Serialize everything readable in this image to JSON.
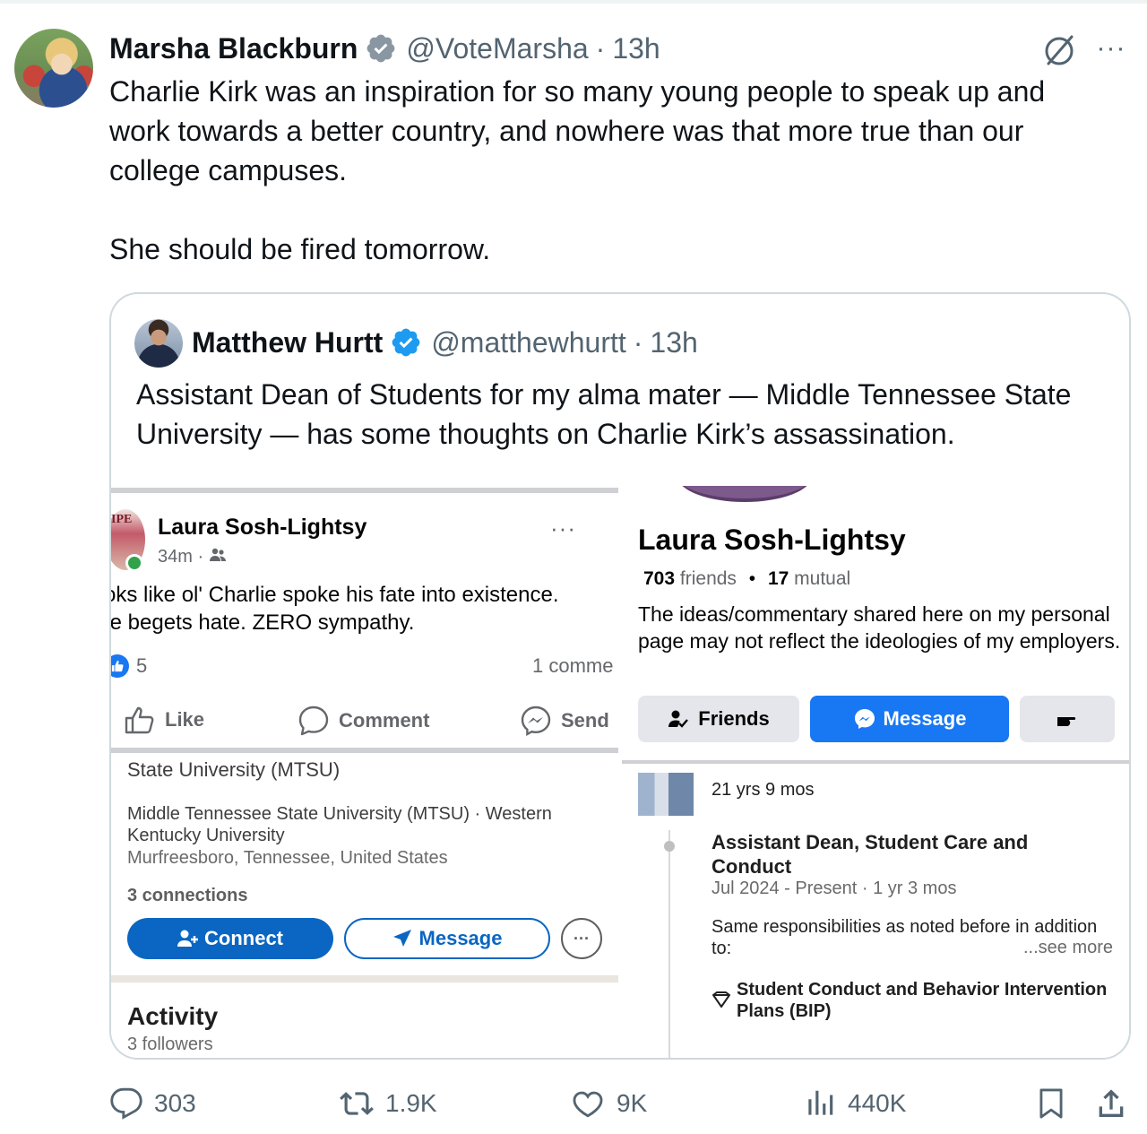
{
  "tweet": {
    "author_name": "Marsha Blackburn",
    "handle": "@VoteMarsha",
    "separator": "·",
    "time": "13h",
    "more": "···",
    "paragraphs": [
      "Charlie Kirk was an inspiration for so many young people to speak up and work towards a better country, and nowhere was that more true than our college campuses.",
      "She should be fired tomorrow."
    ]
  },
  "quote": {
    "author_name": "Matthew Hurtt",
    "handle": "@matthewhurtt",
    "separator": "·",
    "time": "13h",
    "text": "Assistant Dean of Students for my alma mater — Middle Tennessee State University — has some thoughts on Charlie Kirk’s assassination."
  },
  "fb_post": {
    "avatar_text": "IPE",
    "name": "Laura Sosh-Lightsy",
    "meta": "34m · ",
    "dots": "···",
    "line1": "oks like ol' Charlie spoke his fate into existence.",
    "line2": "te begets hate. ZERO sympathy.",
    "reaction_count": "5",
    "comments": "1 comme",
    "like_label": "Like",
    "comment_label": "Comment",
    "send_label": "Send"
  },
  "fb_profile": {
    "name": "Laura Sosh-Lightsy",
    "friends_count": "703",
    "friends_word": "friends",
    "bullet": "•",
    "mutual_count": "17",
    "mutual_word": "mutual",
    "bio": "The ideas/commentary shared here on my personal page may not reflect the ideologies of my employers.",
    "friends_btn": "Friends",
    "message_btn": "Message"
  },
  "li_card": {
    "cut_line": "State University (MTSU)",
    "education": "Middle Tennessee State University (MTSU) · Western Kentucky University",
    "location": "Murfreesboro, Tennessee, United States",
    "connections": "3 connections",
    "connect_btn": "Connect",
    "message_btn": "Message",
    "more": "···",
    "activity_title": "Activity",
    "followers": "3 followers"
  },
  "li_exp": {
    "duration": "21 yrs 9 mos",
    "role": "Assistant Dean, Student Care and Conduct",
    "dates": "Jul 2024 - Present · 1 yr 3 mos",
    "desc": "Same responsibilities as noted before in addition to:",
    "see_more": "...see more",
    "skill": "Student Conduct and Behavior Intervention Plans (BIP)"
  },
  "actions": {
    "replies": "303",
    "reposts": "1.9K",
    "likes": "9K",
    "views": "440K"
  },
  "colors": {
    "text": "#0f1419",
    "muted": "#536471",
    "verified": "#1d9bf0",
    "fb_blue": "#1877f2",
    "li_blue": "#0a66c2"
  },
  "icons": [
    "verified-badge-icon",
    "grok-icon",
    "more-icon",
    "reply-icon",
    "repost-icon",
    "like-icon",
    "views-icon",
    "bookmark-icon",
    "share-icon"
  ]
}
